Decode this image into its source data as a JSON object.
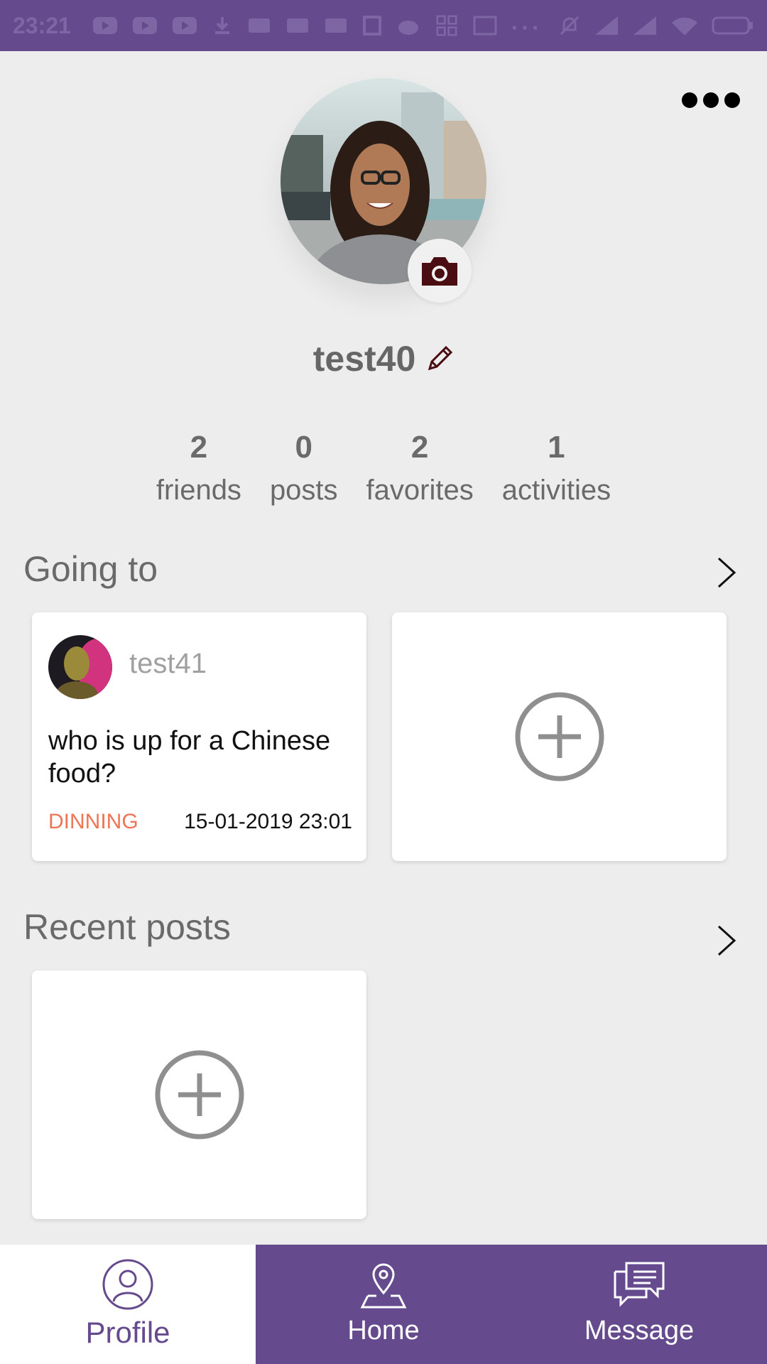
{
  "status_bar": {
    "time": "23:21"
  },
  "profile": {
    "username": "test40",
    "stats": [
      {
        "value": "2",
        "label": "friends"
      },
      {
        "value": "0",
        "label": "posts"
      },
      {
        "value": "2",
        "label": "favorites"
      },
      {
        "value": "1",
        "label": "activities"
      }
    ]
  },
  "going_to": {
    "title": "Going to",
    "card": {
      "user": "test41",
      "text": "who is up for a Chinese food?",
      "category": "DINNING",
      "datetime": "15-01-2019 23:01"
    }
  },
  "recent_posts": {
    "title": "Recent posts"
  },
  "nav": {
    "items": [
      {
        "label": "Profile"
      },
      {
        "label": "Home"
      },
      {
        "label": "Message"
      }
    ]
  },
  "colors": {
    "brand_purple": "#654a8d",
    "category_orange": "#ef7554",
    "background": "#ededed"
  },
  "icons": [
    "more-icon",
    "camera-icon",
    "pencil-icon",
    "chevron-right-icon",
    "plus-circle-icon",
    "profile-icon",
    "home-pin-icon",
    "message-icon"
  ]
}
